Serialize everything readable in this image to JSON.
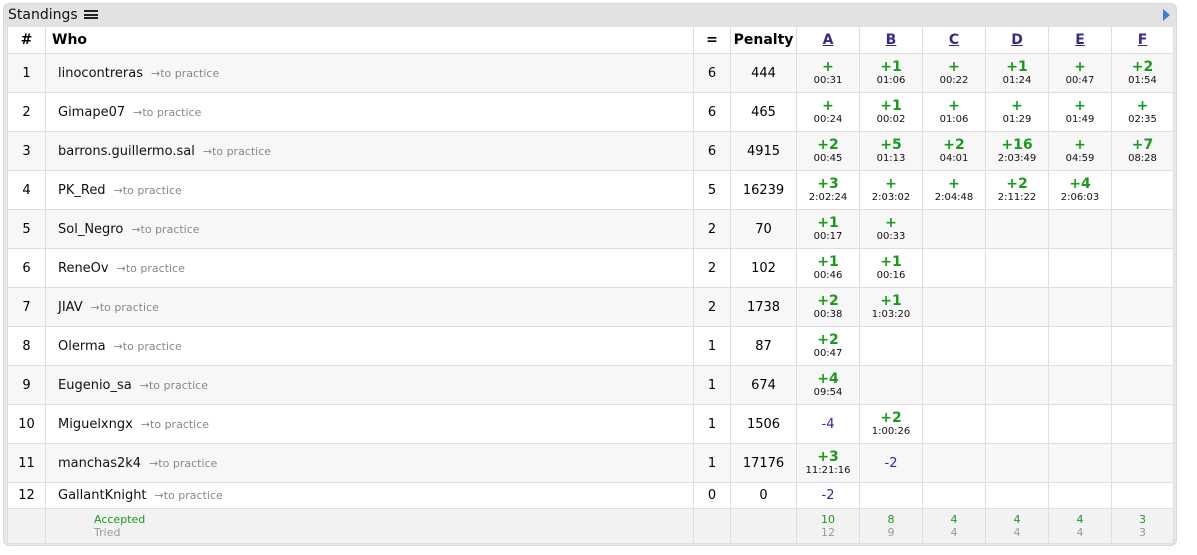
{
  "panel": {
    "title": "Standings",
    "title_icon": "list-icon",
    "expand_icon": "expand-arrow-icon"
  },
  "columns": {
    "rank": "#",
    "who": "Who",
    "solved": "=",
    "penalty": "Penalty",
    "problems": [
      "A",
      "B",
      "C",
      "D",
      "E",
      "F"
    ]
  },
  "practice_label": "→to practice",
  "rows": [
    {
      "rank": "1",
      "name": "linocontreras",
      "solved": "6",
      "penalty": "444",
      "cells": [
        {
          "res": "+",
          "time": "00:31"
        },
        {
          "res": "+1",
          "time": "01:06"
        },
        {
          "res": "+",
          "time": "00:22"
        },
        {
          "res": "+1",
          "time": "01:24"
        },
        {
          "res": "+",
          "time": "00:47"
        },
        {
          "res": "+2",
          "time": "01:54"
        }
      ]
    },
    {
      "rank": "2",
      "name": "Gimape07",
      "solved": "6",
      "penalty": "465",
      "cells": [
        {
          "res": "+",
          "time": "00:24"
        },
        {
          "res": "+1",
          "time": "00:02"
        },
        {
          "res": "+",
          "time": "01:06"
        },
        {
          "res": "+",
          "time": "01:29"
        },
        {
          "res": "+",
          "time": "01:49"
        },
        {
          "res": "+",
          "time": "02:35"
        }
      ]
    },
    {
      "rank": "3",
      "name": "barrons.guillermo.sal",
      "solved": "6",
      "penalty": "4915",
      "cells": [
        {
          "res": "+2",
          "time": "00:45"
        },
        {
          "res": "+5",
          "time": "01:13"
        },
        {
          "res": "+2",
          "time": "04:01"
        },
        {
          "res": "+16",
          "time": "2:03:49"
        },
        {
          "res": "+",
          "time": "04:59"
        },
        {
          "res": "+7",
          "time": "08:28"
        }
      ]
    },
    {
      "rank": "4",
      "name": "PK_Red",
      "solved": "5",
      "penalty": "16239",
      "cells": [
        {
          "res": "+3",
          "time": "2:02:24"
        },
        {
          "res": "+",
          "time": "2:03:02"
        },
        {
          "res": "+",
          "time": "2:04:48"
        },
        {
          "res": "+2",
          "time": "2:11:22"
        },
        {
          "res": "+4",
          "time": "2:06:03"
        },
        {
          "res": "",
          "time": ""
        }
      ]
    },
    {
      "rank": "5",
      "name": "Sol_Negro",
      "solved": "2",
      "penalty": "70",
      "cells": [
        {
          "res": "+1",
          "time": "00:17"
        },
        {
          "res": "+",
          "time": "00:33"
        },
        {
          "res": "",
          "time": ""
        },
        {
          "res": "",
          "time": ""
        },
        {
          "res": "",
          "time": ""
        },
        {
          "res": "",
          "time": ""
        }
      ]
    },
    {
      "rank": "6",
      "name": "ReneOv",
      "solved": "2",
      "penalty": "102",
      "cells": [
        {
          "res": "+1",
          "time": "00:46"
        },
        {
          "res": "+1",
          "time": "00:16"
        },
        {
          "res": "",
          "time": ""
        },
        {
          "res": "",
          "time": ""
        },
        {
          "res": "",
          "time": ""
        },
        {
          "res": "",
          "time": ""
        }
      ]
    },
    {
      "rank": "7",
      "name": "JIAV",
      "solved": "2",
      "penalty": "1738",
      "cells": [
        {
          "res": "+2",
          "time": "00:38"
        },
        {
          "res": "+1",
          "time": "1:03:20"
        },
        {
          "res": "",
          "time": ""
        },
        {
          "res": "",
          "time": ""
        },
        {
          "res": "",
          "time": ""
        },
        {
          "res": "",
          "time": ""
        }
      ]
    },
    {
      "rank": "8",
      "name": "Olerma",
      "solved": "1",
      "penalty": "87",
      "cells": [
        {
          "res": "+2",
          "time": "00:47"
        },
        {
          "res": "",
          "time": ""
        },
        {
          "res": "",
          "time": ""
        },
        {
          "res": "",
          "time": ""
        },
        {
          "res": "",
          "time": ""
        },
        {
          "res": "",
          "time": ""
        }
      ]
    },
    {
      "rank": "9",
      "name": "Eugenio_sa",
      "solved": "1",
      "penalty": "674",
      "cells": [
        {
          "res": "+4",
          "time": "09:54"
        },
        {
          "res": "",
          "time": ""
        },
        {
          "res": "",
          "time": ""
        },
        {
          "res": "",
          "time": ""
        },
        {
          "res": "",
          "time": ""
        },
        {
          "res": "",
          "time": ""
        }
      ]
    },
    {
      "rank": "10",
      "name": "Miguelxngx",
      "solved": "1",
      "penalty": "1506",
      "cells": [
        {
          "res": "-4",
          "time": ""
        },
        {
          "res": "+2",
          "time": "1:00:26"
        },
        {
          "res": "",
          "time": ""
        },
        {
          "res": "",
          "time": ""
        },
        {
          "res": "",
          "time": ""
        },
        {
          "res": "",
          "time": ""
        }
      ]
    },
    {
      "rank": "11",
      "name": "manchas2k4",
      "solved": "1",
      "penalty": "17176",
      "cells": [
        {
          "res": "+3",
          "time": "11:21:16"
        },
        {
          "res": "-2",
          "time": ""
        },
        {
          "res": "",
          "time": ""
        },
        {
          "res": "",
          "time": ""
        },
        {
          "res": "",
          "time": ""
        },
        {
          "res": "",
          "time": ""
        }
      ]
    },
    {
      "rank": "12",
      "name": "GallantKnight",
      "solved": "0",
      "penalty": "0",
      "cells": [
        {
          "res": "-2",
          "time": ""
        },
        {
          "res": "",
          "time": ""
        },
        {
          "res": "",
          "time": ""
        },
        {
          "res": "",
          "time": ""
        },
        {
          "res": "",
          "time": ""
        },
        {
          "res": "",
          "time": ""
        }
      ]
    }
  ],
  "footer": {
    "accepted_label": "Accepted",
    "tried_label": "Tried",
    "accepted": [
      "10",
      "8",
      "4",
      "4",
      "4",
      "3"
    ],
    "tried": [
      "12",
      "9",
      "4",
      "4",
      "4",
      "3"
    ]
  },
  "colors": {
    "accepted": "#1a9a1a",
    "rejected": "#2a2aaa",
    "link": "#3b2a8a"
  }
}
